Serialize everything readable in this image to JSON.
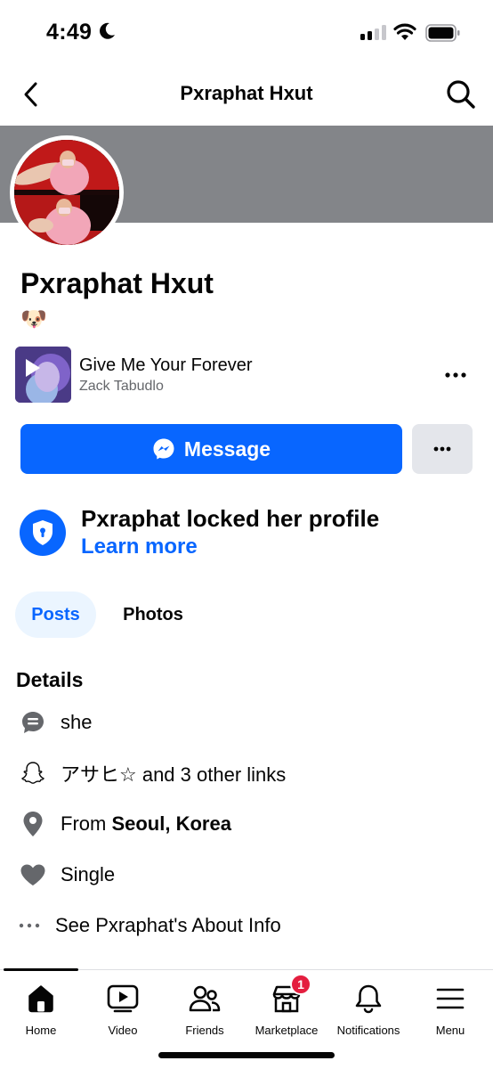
{
  "status_bar": {
    "time": "4:49"
  },
  "header": {
    "title": "Pxraphat Hxut"
  },
  "profile": {
    "name": "Pxraphat Hxut",
    "emoji": "🐶"
  },
  "music": {
    "song": "Give Me Your Forever",
    "artist": "Zack Tabudlo"
  },
  "actions": {
    "message_label": "Message"
  },
  "locked": {
    "title": "Pxraphat locked her profile",
    "link": "Learn more"
  },
  "tabs": [
    {
      "label": "Posts",
      "active": true
    },
    {
      "label": "Photos",
      "active": false
    }
  ],
  "details": {
    "heading": "Details",
    "pronoun": "she",
    "links": "アサヒ☆ and 3 other links",
    "from_prefix": "From",
    "from_place": "Seoul, Korea",
    "relationship": "Single",
    "about": "See Pxraphat's About Info"
  },
  "bottom_nav": [
    {
      "label": "Home",
      "icon": "home-icon"
    },
    {
      "label": "Video",
      "icon": "video-icon"
    },
    {
      "label": "Friends",
      "icon": "friends-icon"
    },
    {
      "label": "Marketplace",
      "icon": "marketplace-icon",
      "badge": "1"
    },
    {
      "label": "Notifications",
      "icon": "bell-icon"
    },
    {
      "label": "Menu",
      "icon": "menu-icon"
    }
  ],
  "colors": {
    "accent": "#0866ff",
    "cover": "#838589",
    "badge": "#e41e3f",
    "secondary_text": "#65676b"
  }
}
